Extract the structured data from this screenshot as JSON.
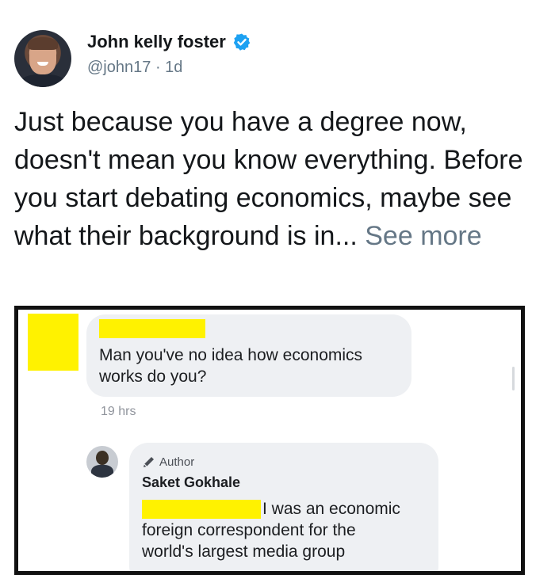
{
  "tweet": {
    "display_name": "John kelly foster",
    "handle": "@john17",
    "time": "1d",
    "separator": "·",
    "text": "Just because you have a degree now, doesn't mean you know everything. Before you start debating economics, maybe see what their background is in...",
    "see_more": "See more",
    "icons": {
      "avatar": "profile-photo",
      "verified": "verified-badge-icon"
    },
    "colors": {
      "verified": "#1da1f2",
      "meta": "#657786"
    }
  },
  "embedded_image": {
    "comment1": {
      "text": "Man you've no idea how economics works do you?",
      "timestamp": "19 hrs"
    },
    "reply": {
      "badge": "Author",
      "name": "Saket Gokhale",
      "text_line1": "I was an economic",
      "text_line2": "foreign correspondent for the",
      "text_line3": "world's largest media group"
    },
    "colors": {
      "redaction": "#fff200",
      "bubble": "#eef0f3"
    }
  }
}
